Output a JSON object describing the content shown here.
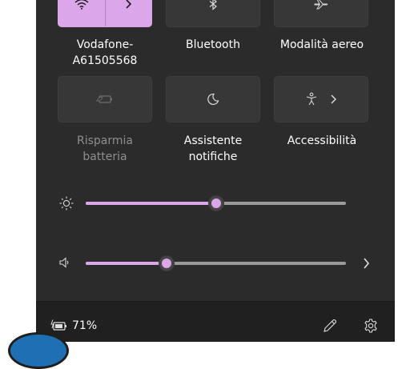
{
  "tiles": {
    "wifi": {
      "label": "Vodafone-\nA61505568",
      "label_line1": "Vodafone-",
      "label_line2": "A61505568",
      "icon": "wifi-icon",
      "expand_icon": "chevron-right-icon",
      "active": true
    },
    "bluetooth": {
      "label_line1": "Bluetooth",
      "icon": "bluetooth-icon",
      "active": false
    },
    "airplane": {
      "label_line1": "Modalità aereo",
      "icon": "airplane-icon",
      "active": false
    },
    "battery_saver": {
      "label_line1": "Risparmia",
      "label_line2": "batteria",
      "icon": "battery-saver-icon",
      "disabled": true
    },
    "focus_assist": {
      "label_line1": "Assistente",
      "label_line2": "notifiche",
      "icon": "moon-icon",
      "active": false
    },
    "accessibility": {
      "label_line1": "Accessibilità",
      "icon": "accessibility-icon",
      "expand_icon": "chevron-right-icon",
      "active": false
    }
  },
  "sliders": {
    "brightness": {
      "icon": "sun-icon",
      "value_percent": 50
    },
    "volume": {
      "icon": "speaker-icon",
      "value_percent": 31,
      "expand_icon": "chevron-right-icon"
    }
  },
  "footer": {
    "battery_icon": "battery-charging-icon",
    "battery_percent": "71%",
    "edit_icon": "pencil-icon",
    "settings_icon": "gear-icon"
  },
  "colors": {
    "accent": "#dca6ea",
    "panel_bg": "#2b2b2b",
    "tile_bg": "#373737",
    "footer_bg": "#202020"
  }
}
